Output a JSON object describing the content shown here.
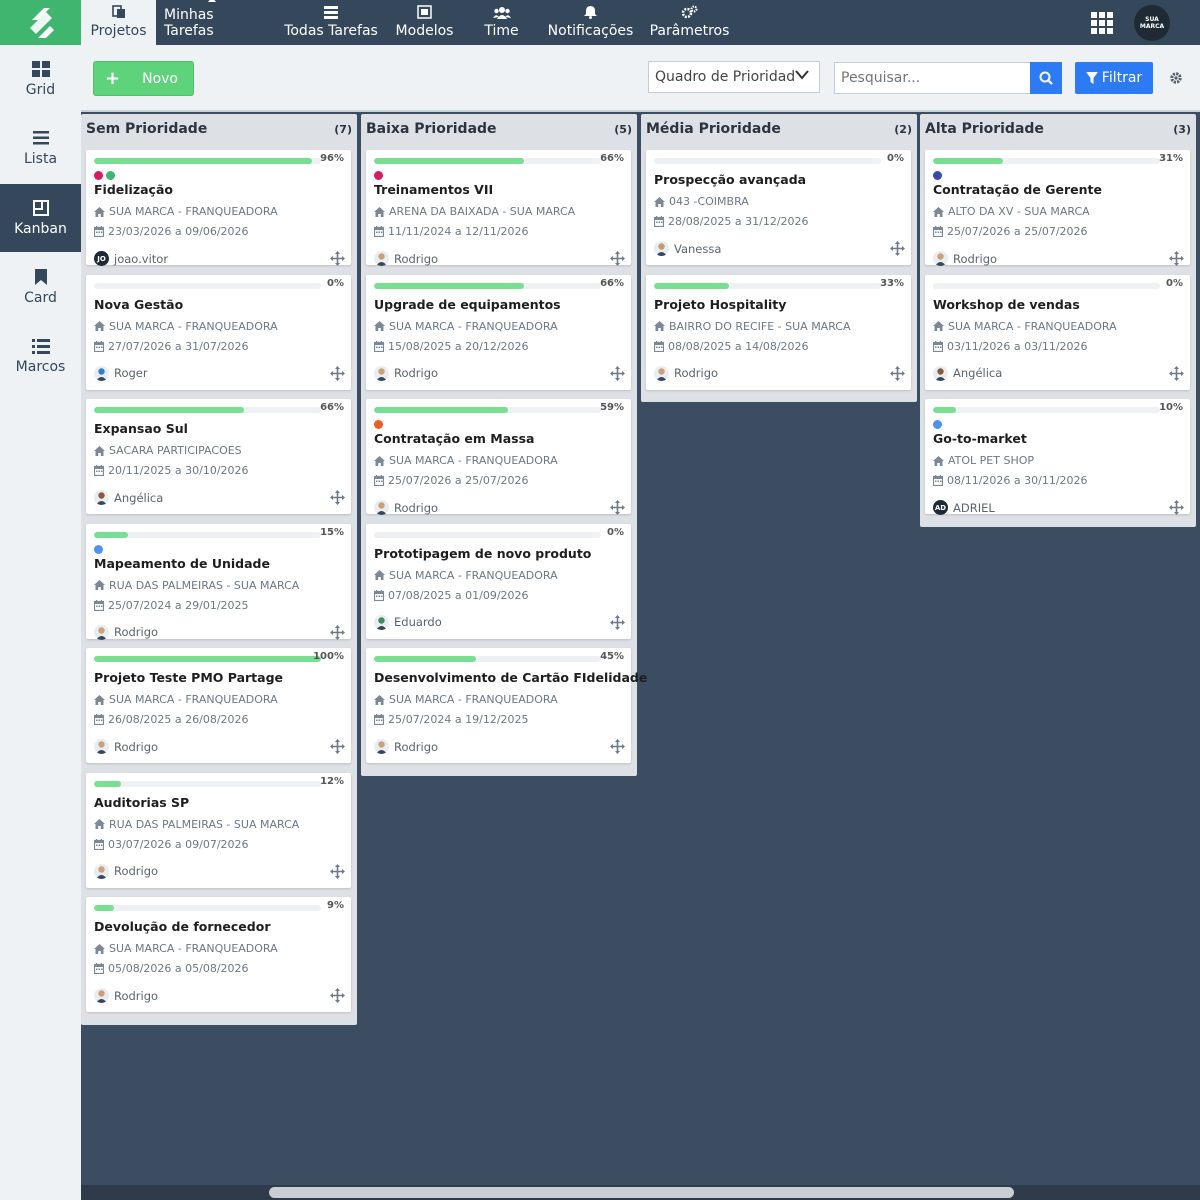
{
  "nav": {
    "items": [
      {
        "label": "Projetos",
        "icon": "folder-icon",
        "active": true
      },
      {
        "label": "Minhas Tarefas",
        "icon": "user-list-icon",
        "active": false
      },
      {
        "label": "Todas Tarefas",
        "icon": "list-icon",
        "active": false
      },
      {
        "label": "Modelos",
        "icon": "template-icon",
        "active": false
      },
      {
        "label": "Time",
        "icon": "team-icon",
        "active": false
      },
      {
        "label": "Notificações",
        "icon": "bell-icon",
        "active": false
      },
      {
        "label": "Parâmetros",
        "icon": "cogs-icon",
        "active": false
      }
    ],
    "brand_avatar": "SUA MARCA"
  },
  "sidebar": {
    "items": [
      {
        "label": "Grid",
        "icon": "grid-icon",
        "active": false
      },
      {
        "label": "Lista",
        "icon": "bars-icon",
        "active": false
      },
      {
        "label": "Kanban",
        "icon": "kanban-icon",
        "active": true
      },
      {
        "label": "Card",
        "icon": "bookmark-icon",
        "active": false
      },
      {
        "label": "Marcos",
        "icon": "milestones-icon",
        "active": false
      }
    ]
  },
  "toolbar": {
    "new_label": "Novo",
    "view_select": "Quadro de Prioridade",
    "search_placeholder": "Pesquisar...",
    "filter_label": "Filtrar"
  },
  "columns": [
    {
      "title": "Sem Prioridade",
      "count": "(7)",
      "cards": [
        {
          "pct": "96%",
          "progress": 0.96,
          "tags": [
            "#d81b60",
            "#3fb56f"
          ],
          "title": "Fidelização",
          "company": "SUA MARCA - FRANQUEADORA",
          "dates": "23/03/2026 a 09/06/2026",
          "user": "joao.vitor",
          "avatar": "JO"
        },
        {
          "pct": "0%",
          "progress": 0,
          "tags": [],
          "title": "Nova Gestão",
          "company": "SUA MARCA - FRANQUEADORA",
          "dates": "27/07/2026 a 31/07/2026",
          "user": "Roger",
          "avatar": ""
        },
        {
          "pct": "66%",
          "progress": 0.66,
          "tags": [],
          "title": "Expansao Sul",
          "company": "SACARA PARTICIPACOES",
          "dates": "20/11/2025 a 30/10/2026",
          "user": "Angélica",
          "avatar": ""
        },
        {
          "pct": "15%",
          "progress": 0.15,
          "tags": [
            "#4d94f2"
          ],
          "title": "Mapeamento de Unidade",
          "company": "RUA DAS PALMEIRAS - SUA MARCA",
          "dates": "25/07/2024 a 29/01/2025",
          "user": "Rodrigo",
          "avatar": ""
        },
        {
          "pct": "100%",
          "progress": 1,
          "tags": [],
          "title": "Projeto Teste PMO Partage",
          "company": "SUA MARCA - FRANQUEADORA",
          "dates": "26/08/2025 a 26/08/2026",
          "user": "Rodrigo",
          "avatar": ""
        },
        {
          "pct": "12%",
          "progress": 0.12,
          "tags": [],
          "title": "Auditorias SP",
          "company": "RUA DAS PALMEIRAS - SUA MARCA",
          "dates": "03/07/2026 a 09/07/2026",
          "user": "Rodrigo",
          "avatar": ""
        },
        {
          "pct": "9%",
          "progress": 0.09,
          "tags": [],
          "title": "Devolução de fornecedor",
          "company": "SUA MARCA - FRANQUEADORA",
          "dates": "05/08/2026 a 05/08/2026",
          "user": "Rodrigo",
          "avatar": ""
        }
      ]
    },
    {
      "title": "Baixa Prioridade",
      "count": "(5)",
      "cards": [
        {
          "pct": "66%",
          "progress": 0.66,
          "tags": [
            "#d81b60"
          ],
          "title": "Treinamentos VII",
          "company": "ARENA DA BAIXADA - SUA MARCA",
          "dates": "11/11/2024 a 12/11/2026",
          "user": "Rodrigo",
          "avatar": ""
        },
        {
          "pct": "66%",
          "progress": 0.66,
          "tags": [],
          "title": "Upgrade de equipamentos",
          "company": "SUA MARCA - FRANQUEADORA",
          "dates": "15/08/2025 a 20/12/2026",
          "user": "Rodrigo",
          "avatar": ""
        },
        {
          "pct": "59%",
          "progress": 0.59,
          "tags": [
            "#f05a24"
          ],
          "title": "Contratação em Massa",
          "company": "SUA MARCA - FRANQUEADORA",
          "dates": "25/07/2026 a 25/07/2026",
          "user": "Rodrigo",
          "avatar": ""
        },
        {
          "pct": "0%",
          "progress": 0,
          "tags": [],
          "title": "Prototipagem de novo produto",
          "company": "SUA MARCA - FRANQUEADORA",
          "dates": "07/08/2025 a 01/09/2026",
          "user": "Eduardo",
          "avatar": ""
        },
        {
          "pct": "45%",
          "progress": 0.45,
          "tags": [],
          "title": "Desenvolvimento de Cartão FIdelidade",
          "company": "SUA MARCA - FRANQUEADORA",
          "dates": "25/07/2024 a 19/12/2025",
          "user": "Rodrigo",
          "avatar": ""
        }
      ]
    },
    {
      "title": "Média Prioridade",
      "count": "(2)",
      "cards": [
        {
          "pct": "0%",
          "progress": 0,
          "tags": [],
          "title": "Prospecção avançada",
          "company": "043 -COIMBRA",
          "dates": "28/08/2025 a 31/12/2026",
          "user": "Vanessa",
          "avatar": ""
        },
        {
          "pct": "33%",
          "progress": 0.33,
          "tags": [],
          "title": "Projeto Hospitality",
          "company": "BAIRRO DO RECIFE - SUA MARCA",
          "dates": "08/08/2025 a 14/08/2026",
          "user": "Rodrigo",
          "avatar": ""
        }
      ]
    },
    {
      "title": "Alta Prioridade",
      "count": "(3)",
      "cards": [
        {
          "pct": "31%",
          "progress": 0.31,
          "tags": [
            "#3949ab"
          ],
          "title": "Contratação de Gerente",
          "company": "ALTO DA XV - SUA MARCA",
          "dates": "25/07/2026 a 25/07/2026",
          "user": "Rodrigo",
          "avatar": ""
        },
        {
          "pct": "0%",
          "progress": 0,
          "tags": [],
          "title": "Workshop de vendas",
          "company": "SUA MARCA - FRANQUEADORA",
          "dates": "03/11/2026 a 03/11/2026",
          "user": "Angélica",
          "avatar": ""
        },
        {
          "pct": "10%",
          "progress": 0.1,
          "tags": [
            "#4d94f2"
          ],
          "title": "Go-to-market",
          "company": "ATOL PET SHOP",
          "dates": "08/11/2026 a 30/11/2026",
          "user": "ADRIEL",
          "avatar": "AD"
        }
      ]
    }
  ]
}
